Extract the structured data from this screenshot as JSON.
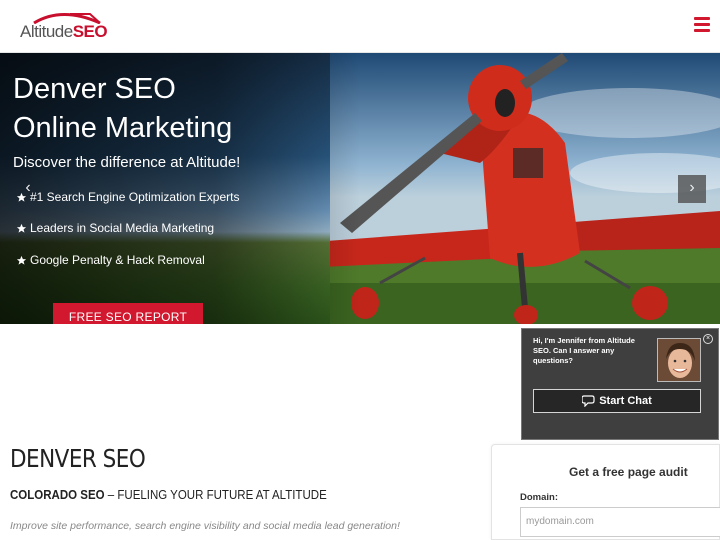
{
  "header": {
    "logo_alt": "AltitudeSEO",
    "logo_prefix": "Altitude",
    "logo_suffix": "SEO",
    "menu_icon": "hamburger-icon"
  },
  "hero": {
    "title_line1": "Denver SEO",
    "title_line2": "Online Marketing",
    "subtitle": "Discover the difference at Altitude!",
    "bullets": [
      "#1 Search Engine Optimization Experts",
      "Leaders in Social Media Marketing",
      "Google Penalty & Hack Removal"
    ],
    "cta_label": "FREE SEO REPORT",
    "prev_icon": "chevron-left-icon",
    "next_icon": "chevron-right-icon",
    "prev_glyph": "‹",
    "next_glyph": "›"
  },
  "content": {
    "heading": "DENVER SEO",
    "tagline_bold": "COLORADO SEO",
    "tagline_rest": " – FUELING YOUR FUTURE AT ALTITUDE",
    "intro": "Improve site performance, search engine visibility and social media lead generation!"
  },
  "chat": {
    "message": "Hi, I'm Jennifer from Altitude SEO. Can I answer any questions?",
    "button_label": "Start Chat",
    "close_glyph": "×"
  },
  "audit": {
    "title": "Get a free page audit",
    "domain_label": "Domain:",
    "domain_placeholder": "mydomain.com"
  },
  "colors": {
    "brand_red": "#d1182f",
    "chat_bg": "#3f3f3f"
  }
}
